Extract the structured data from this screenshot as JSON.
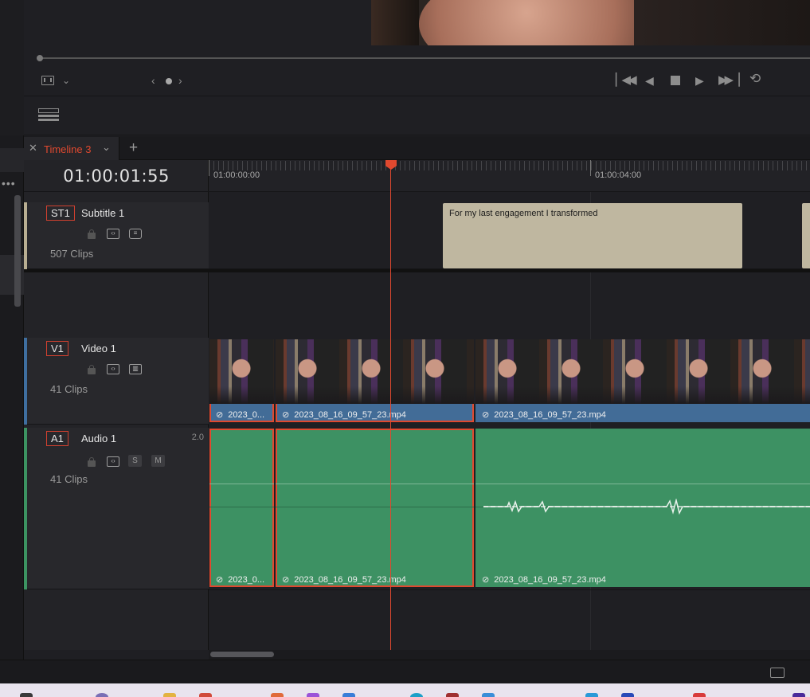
{
  "timeline": {
    "tab_label": "Timeline 3",
    "timecode": "01:00:01:55",
    "ruler_labels": [
      "01:00:00:00",
      "01:00:04:00"
    ]
  },
  "tracks": {
    "subtitle": {
      "badge": "ST1",
      "name": "Subtitle 1",
      "clip_count": "507 Clips"
    },
    "video": {
      "badge": "V1",
      "name": "Video 1",
      "clip_count": "41 Clips"
    },
    "audio": {
      "badge": "A1",
      "name": "Audio 1",
      "channels": "2.0",
      "clip_count": "41 Clips",
      "solo_label": "S",
      "mute_label": "M"
    }
  },
  "clips": {
    "subtitle_text": "For my last engagement I transformed",
    "video": [
      "2023_0...",
      "2023_08_16_09_57_23.mp4",
      "2023_08_16_09_57_23.mp4"
    ],
    "audio": [
      "2023_0...",
      "2023_08_16_09_57_23.mp4",
      "2023_08_16_09_57_23.mp4"
    ]
  },
  "icons": {
    "transport": [
      "skip-to-start-icon",
      "step-back-icon",
      "stop-icon",
      "play-icon",
      "skip-to-end-icon",
      "loop-icon"
    ],
    "viewer": [
      "viewer-layout-icon",
      "chevron-down-icon",
      "prev-icon",
      "dot-icon",
      "next-icon"
    ]
  },
  "colors": {
    "accent_red": "#e0492f",
    "video_clip": "#426c97",
    "audio_clip": "#3d9163",
    "subtitle_clip": "#bfb7a0"
  }
}
